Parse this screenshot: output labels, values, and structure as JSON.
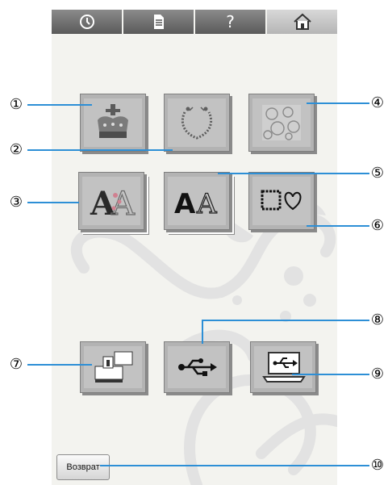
{
  "toolbar": {
    "buttons": [
      {
        "icon": "clock-icon"
      },
      {
        "icon": "document-icon"
      },
      {
        "icon": "help-icon",
        "label": "?"
      },
      {
        "icon": "home-icon"
      }
    ]
  },
  "categories": [
    {
      "icon": "crown-pattern-icon"
    },
    {
      "icon": "wreath-pattern-icon"
    },
    {
      "icon": "quilt-pattern-icon"
    },
    {
      "icon": "floral-alphabet-icon",
      "label": "AA"
    },
    {
      "icon": "character-font-icon",
      "label": "AA"
    },
    {
      "icon": "frame-pattern-icon"
    },
    {
      "icon": "embroidery-machine-memory-icon"
    },
    {
      "icon": "usb-icon"
    },
    {
      "icon": "computer-usb-icon"
    }
  ],
  "back_button": {
    "label": "Возврат"
  },
  "callouts": [
    "①",
    "②",
    "③",
    "④",
    "⑤",
    "⑥",
    "⑦",
    "⑧",
    "⑨",
    "⑩"
  ],
  "colors": {
    "callout_line": "#2d8fd6",
    "toolbar": "#6e6e6e",
    "button": "#b3b3b3"
  }
}
